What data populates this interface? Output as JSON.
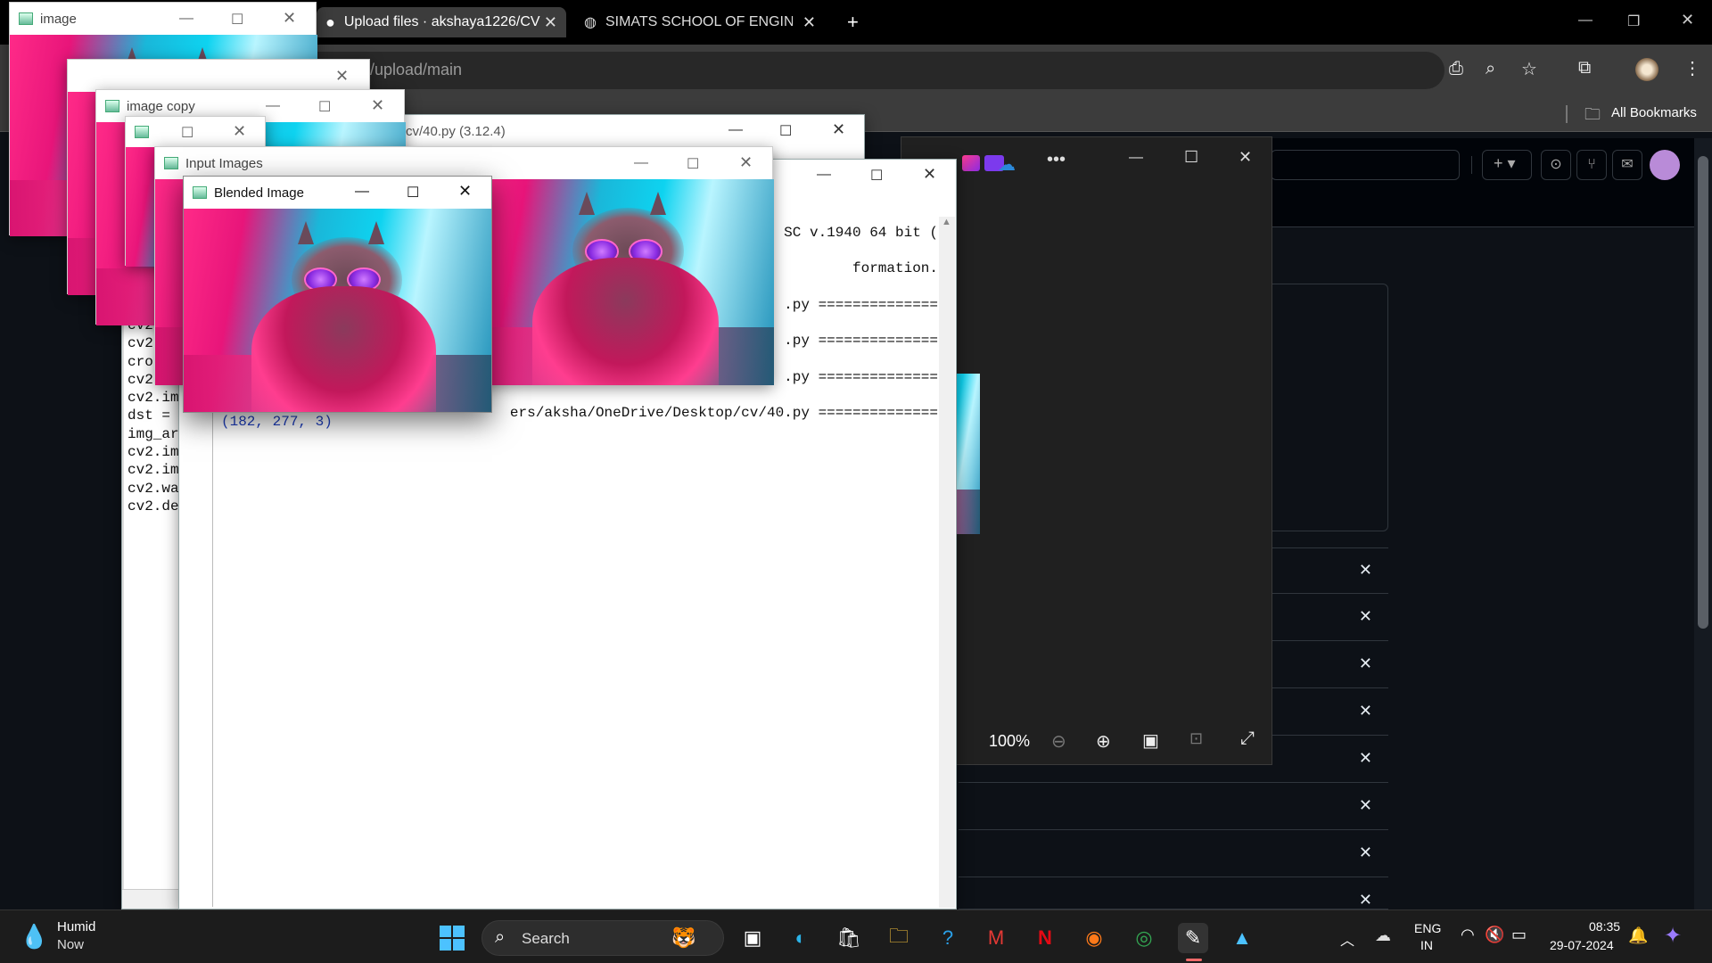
{
  "chrome": {
    "tabs": [
      {
        "label": "Upload files · akshaya1226/CV"
      },
      {
        "label": "SIMATS SCHOOL OF ENGINEERI"
      }
    ],
    "new_tab": "+",
    "url_fragment": "/upload/main",
    "bookmarks_label": "All Bookmarks"
  },
  "windows": {
    "image": {
      "title": "image"
    },
    "image_copy": {
      "title": "image copy"
    },
    "input_images": {
      "title": "Input Images"
    },
    "blended_image": {
      "title": "Blended Image"
    },
    "idle_editor": {
      "title_fragment": "cv/40.py (3.12.4)"
    }
  },
  "editor_lines": [
    "cv2",
    "cv2",
    "cro",
    "cv2",
    "cv2.im",
    "dst =",
    "img_ar",
    "cv2.im",
    "cv2.im",
    "cv2.wa",
    "cv2.de"
  ],
  "shell": {
    "lines": [
      "SC v.1940 64 bit (",
      "formation.",
      ".py ==============",
      ".py ==============",
      ".py ==============",
      "ers/aksha/OneDrive/Desktop/cv/40.py =============="
    ],
    "output": "(182, 277, 3)"
  },
  "photos": {
    "zoom": "100%"
  },
  "taskbar": {
    "weather_title": "Humid",
    "weather_sub": "Now",
    "search_label": "Search",
    "lang_top": "ENG",
    "lang_bottom": "IN",
    "time": "08:35",
    "date": "29-07-2024"
  }
}
